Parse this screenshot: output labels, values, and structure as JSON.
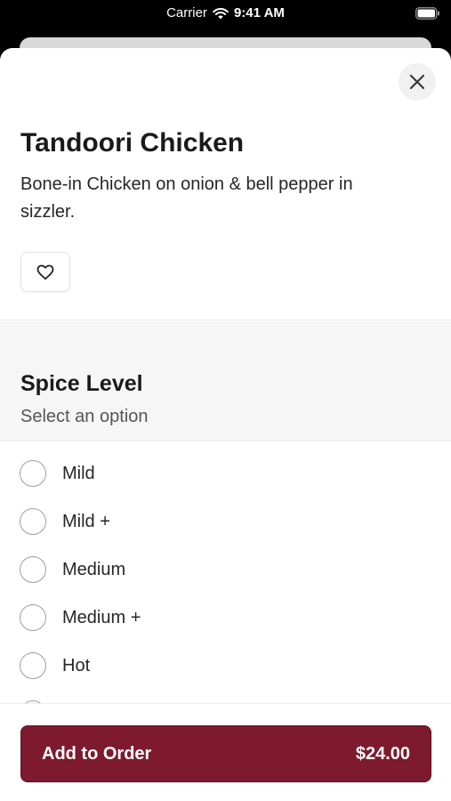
{
  "status_bar": {
    "carrier": "Carrier",
    "time": "9:41 AM"
  },
  "item": {
    "title": "Tandoori Chicken",
    "description": "Bone-in Chicken on onion & bell pepper in sizzler."
  },
  "icons": {
    "close": "close-icon",
    "favorite": "heart-icon",
    "wifi": "wifi-icon",
    "battery": "battery-icon"
  },
  "section": {
    "title": "Spice Level",
    "subtitle": "Select an option",
    "options": [
      {
        "label": "Mild"
      },
      {
        "label": "Mild +"
      },
      {
        "label": "Medium"
      },
      {
        "label": "Medium +"
      },
      {
        "label": "Hot"
      }
    ]
  },
  "footer": {
    "button_label": "Add to Order",
    "price": "$24.00"
  },
  "colors": {
    "accent": "#7d1a2d",
    "section_bg": "#f6f6f6"
  }
}
